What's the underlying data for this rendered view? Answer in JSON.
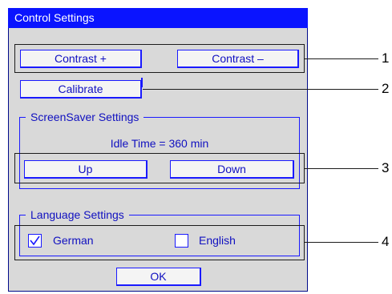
{
  "dialog": {
    "title": "Control Settings",
    "buttons": {
      "contrast_plus": "Contrast +",
      "contrast_minus": "Contrast –",
      "calibrate": "Calibrate",
      "up": "Up",
      "down": "Down",
      "ok": "OK"
    },
    "screensaver": {
      "group_label": "ScreenSaver Settings",
      "idle_time_text": "Idle Time = 360 min"
    },
    "language": {
      "group_label": "Language Settings",
      "options": [
        {
          "label": "German",
          "checked": true
        },
        {
          "label": "English",
          "checked": false
        }
      ]
    }
  },
  "callouts": [
    "1",
    "2",
    "3",
    "4"
  ],
  "colors": {
    "title_bar": "#0a14ff",
    "dialog_background": "#d9d9d9",
    "accent_text": "#1010c0",
    "border": "#1a1aff"
  }
}
